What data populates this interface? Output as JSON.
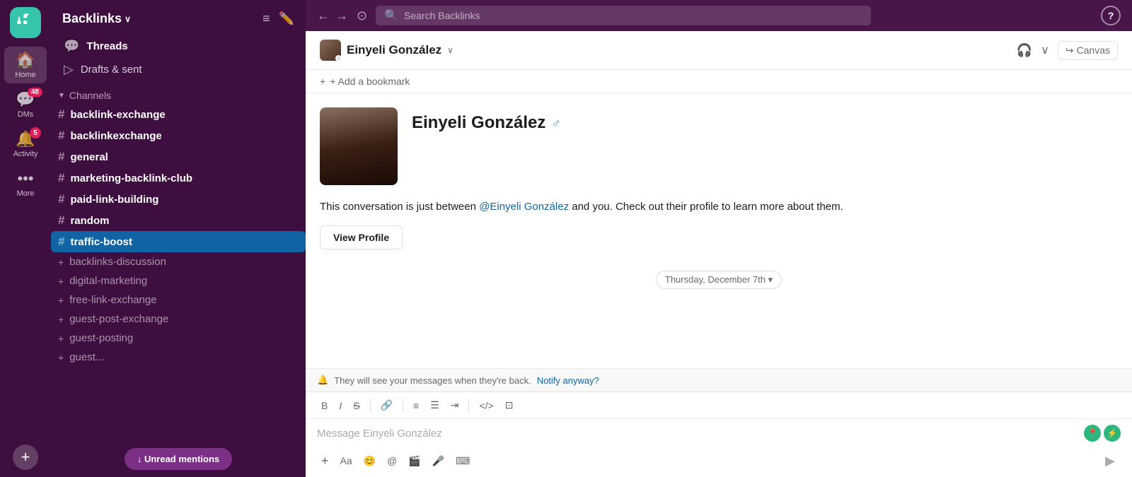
{
  "app": {
    "logo_alt": "Slack logo",
    "search_placeholder": "Search Backlinks",
    "help_icon": "?"
  },
  "icon_bar": {
    "home_label": "Home",
    "dms_label": "DMs",
    "activity_label": "Activity",
    "more_label": "More",
    "dms_badge": "48",
    "activity_badge": "5"
  },
  "sidebar": {
    "workspace_name": "Backlinks",
    "threads_label": "Threads",
    "drafts_label": "Drafts & sent",
    "channels_label": "Channels",
    "channels": [
      {
        "name": "backlink-exchange",
        "bold": true
      },
      {
        "name": "backlinkexchange",
        "bold": true
      },
      {
        "name": "general",
        "bold": true
      },
      {
        "name": "marketing-backlink-club",
        "bold": true
      },
      {
        "name": "paid-link-building",
        "bold": true
      },
      {
        "name": "random",
        "bold": true
      },
      {
        "name": "traffic-boost",
        "bold": true
      }
    ],
    "extra_channels": [
      "backlinks-discussion",
      "digital-marketing",
      "free-link-exchange",
      "guest-post-exchange",
      "guest-posting",
      "guest..."
    ],
    "unread_mentions": "↓ Unread mentions"
  },
  "chat": {
    "user_name": "Einyeli González",
    "canvas_label": "Canvas",
    "bookmark_label": "+ Add a bookmark",
    "profile_name": "Einyeli González",
    "gender_symbol": "♂",
    "intro_text": "This conversation is just between ",
    "mention_text": "@Einyeli González",
    "intro_text2": " and you. Check out their profile to learn more about them.",
    "view_profile_label": "View Profile",
    "date_label": "Thursday, December 7th ▾",
    "away_notice": "They will see your messages when they're back.",
    "notify_link": "Notify anyway?",
    "message_placeholder": "Message Einyeli González",
    "send_icon": "▶"
  },
  "formatting": {
    "bold": "B",
    "italic": "I",
    "strikethrough": "S",
    "link": "🔗",
    "ordered_list": "≡",
    "unordered_list": "☰",
    "indent": "⇥",
    "code": "</>",
    "format_more": "⊡"
  }
}
